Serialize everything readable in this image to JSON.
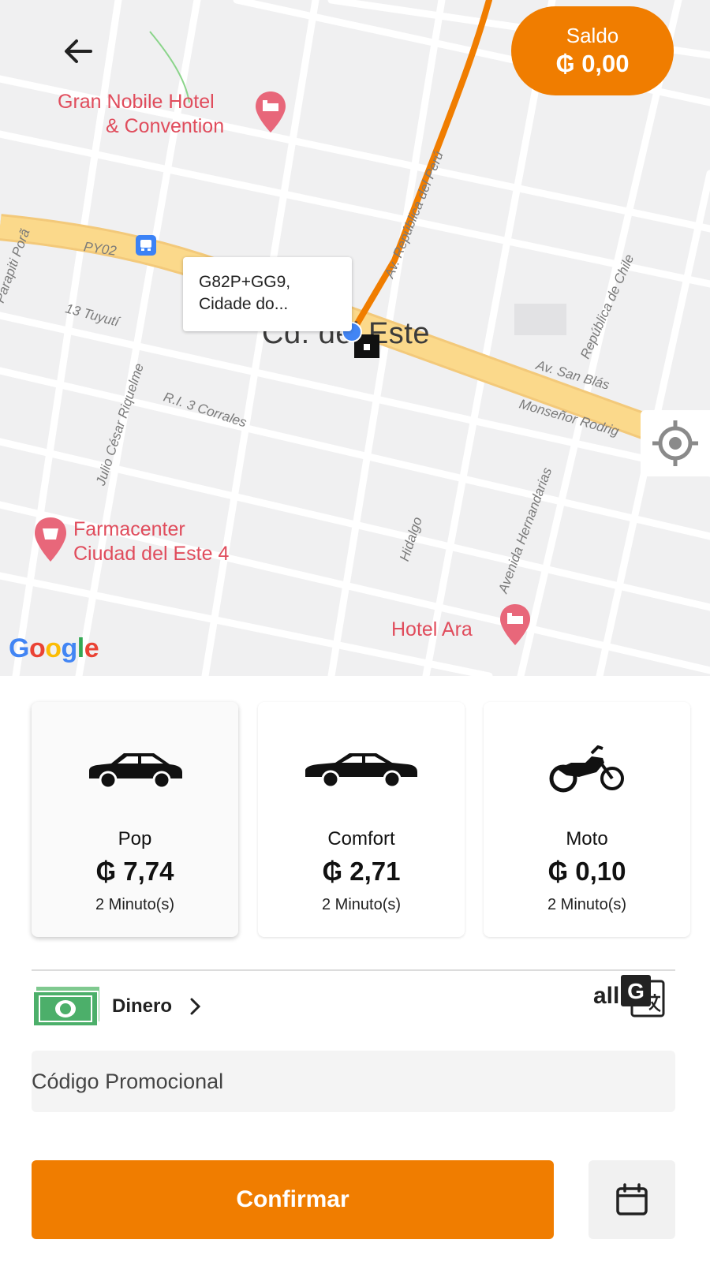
{
  "map": {
    "pois": {
      "hotel_gran_nobile_line1": "Gran Nobile Hotel",
      "hotel_gran_nobile_line2": "& Convention",
      "pharmacy_line1": "Farmacenter",
      "pharmacy_line2": "Ciudad del Este 4",
      "hotel_ara": "Hotel Ara"
    },
    "streets": {
      "py02": "PY02",
      "parapiti": "Parapiti Porã",
      "tuyuti": "13 Tuyutí",
      "julio_cesar": "Julio César Riquelme",
      "corrales": "R.I. 3 Corrales",
      "republica_peru": "Av. República del Perú",
      "republica_chile": "República de Chile",
      "san_blas": "Av. San Blás",
      "monsenor": "Monseñor Rodrig",
      "hidalgo": "Hidalgo",
      "hernandarias": "Avenida Hernandarias"
    },
    "city_label": "Cd. del Este",
    "address_bubble": {
      "line1": "G82P+GG9,",
      "line2": "Cidade do..."
    },
    "google_logo": "Google",
    "colors": {
      "major_road": "#fbd98b",
      "route": "#f07d00",
      "poi": "#e04c5c",
      "location_dot": "#4285f4"
    }
  },
  "balance": {
    "label": "Saldo",
    "value": "₲ 0,00"
  },
  "vehicles": [
    {
      "name": "Pop",
      "price": "₲ 7,74",
      "eta": "2 Minuto(s)",
      "icon": "hatchback-car-icon",
      "selected": true
    },
    {
      "name": "Comfort",
      "price": "₲ 2,71",
      "eta": "2 Minuto(s)",
      "icon": "sedan-car-icon",
      "selected": false
    },
    {
      "name": "Moto",
      "price": "₲ 0,10",
      "eta": "2 Minuto(s)",
      "icon": "motorcycle-icon",
      "selected": false
    }
  ],
  "payment": {
    "method_label": "Dinero",
    "icon": "cash-icon"
  },
  "translate": {
    "label": "all",
    "icon": "google-translate-icon"
  },
  "promo": {
    "placeholder": "Código Promocional",
    "value": ""
  },
  "actions": {
    "confirm_label": "Confirmar",
    "schedule_icon": "calendar-icon"
  },
  "theme": {
    "accent": "#f07d00"
  }
}
